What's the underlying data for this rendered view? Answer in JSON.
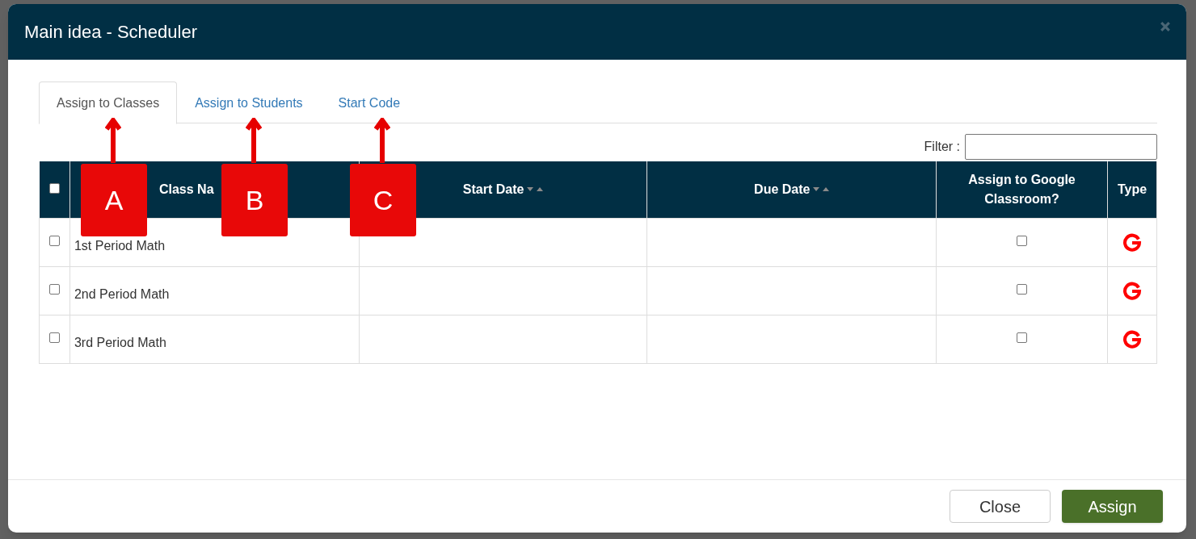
{
  "dialog": {
    "title": "Main idea - Scheduler"
  },
  "tabs": [
    {
      "label": "Assign to Classes",
      "selected": true
    },
    {
      "label": "Assign to Students",
      "selected": false
    },
    {
      "label": "Start Code",
      "selected": false
    }
  ],
  "filter": {
    "label": "Filter :"
  },
  "table": {
    "select_all": {
      "checked": false
    },
    "columns": [
      {
        "label": "Class Na",
        "sortable": false
      },
      {
        "label": "Start Date",
        "sortable": true
      },
      {
        "label": "Due Date",
        "sortable": true
      },
      {
        "label": "Assign to Google Classroom?",
        "sortable": false
      },
      {
        "label": "Type",
        "sortable": false
      }
    ],
    "rows": [
      {
        "checked": false,
        "class_name": "1st Period Math",
        "google_classroom": false
      },
      {
        "checked": false,
        "class_name": "2nd Period Math",
        "google_classroom": false
      },
      {
        "checked": false,
        "class_name": "3rd Period Math",
        "google_classroom": false
      }
    ]
  },
  "callouts": [
    {
      "label": "A"
    },
    {
      "label": "B"
    },
    {
      "label": "C"
    }
  ],
  "buttons": [
    {
      "label": "Close",
      "kind": "secondary"
    },
    {
      "label": "Assign",
      "kind": "primary"
    }
  ]
}
